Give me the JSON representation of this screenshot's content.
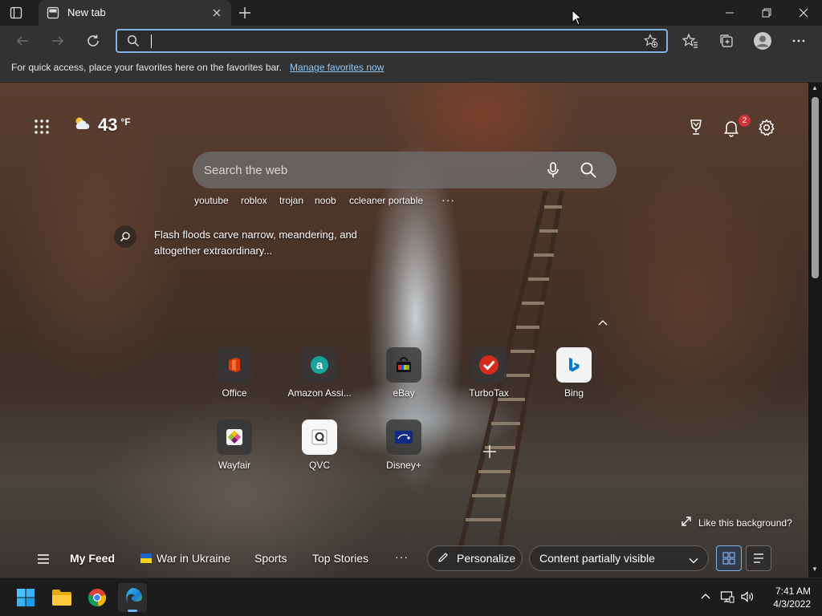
{
  "browser": {
    "tab": {
      "title": "New tab"
    },
    "addressbar": {
      "value": "",
      "placeholder": ""
    },
    "favorites_bar": {
      "message": "For quick access, place your favorites here on the favorites bar.",
      "link": "Manage favorites now"
    }
  },
  "newtab": {
    "weather": {
      "temp": "43",
      "unit": "°F",
      "icon": "partly-cloudy-icon"
    },
    "notifications": {
      "count": "2"
    },
    "search": {
      "placeholder": "Search the web"
    },
    "trending": [
      "youtube",
      "roblox",
      "trojan",
      "noob",
      "ccleaner portable"
    ],
    "trending_more": "···",
    "background": {
      "caption": "Flash floods carve narrow, meandering, and altogether extraordinary...",
      "like_prompt": "Like this background?"
    },
    "quick_links": [
      {
        "label": "Office",
        "icon": "office-icon",
        "color": "#d83b01"
      },
      {
        "label": "Amazon Assi...",
        "icon": "amazon-icon",
        "color": "#1aa39a"
      },
      {
        "label": "eBay",
        "icon": "ebay-icon",
        "color": "#e53238"
      },
      {
        "label": "TurboTax",
        "icon": "turbotax-icon",
        "color": "#d52b1e"
      },
      {
        "label": "Bing",
        "icon": "bing-icon",
        "color": "#0078d4"
      },
      {
        "label": "Wayfair",
        "icon": "wayfair-icon",
        "color": "#7f187f"
      },
      {
        "label": "QVC",
        "icon": "qvc-icon",
        "color": "#333333"
      },
      {
        "label": "Disney+",
        "icon": "disney-plus-icon",
        "color": "#0f2c84"
      }
    ],
    "feed": {
      "my_feed": "My Feed",
      "items": [
        "War in Ukraine",
        "Sports",
        "Top Stories"
      ],
      "more": "···",
      "personalize": "Personalize",
      "layout_select": "Content partially visible"
    }
  },
  "taskbar": {
    "time": "7:41 AM",
    "date": "4/3/2022"
  },
  "colors": {
    "accent": "#7fb3e6",
    "link": "#8ec8f6",
    "badge": "#d13438"
  }
}
